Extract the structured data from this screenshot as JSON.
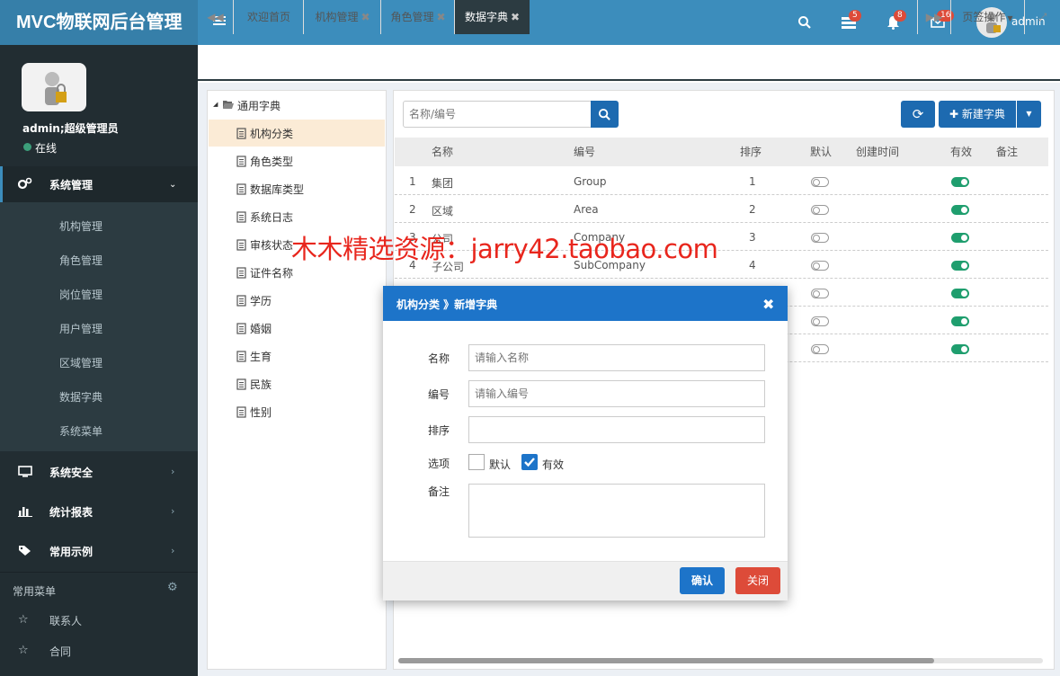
{
  "app": {
    "title": "MVC物联网后台管理"
  },
  "header": {
    "badge_tasks": "5",
    "badge_bell": "8",
    "badge_mail": "16",
    "username": "admin"
  },
  "user": {
    "name": "admin;超级管理员",
    "status": "在线"
  },
  "sidebar": {
    "system_mgmt": "系统管理",
    "sub_items": [
      "机构管理",
      "角色管理",
      "岗位管理",
      "用户管理",
      "区域管理",
      "数据字典",
      "系统菜单"
    ],
    "security": "系统安全",
    "stats": "统计报表",
    "examples": "常用示例",
    "common_menu": "常用菜单",
    "contacts": "联系人",
    "contract": "合同"
  },
  "tabs": {
    "home": "欢迎首页",
    "org": "机构管理",
    "role": "角色管理",
    "dict": "数据字典",
    "page_ops": "页签操作"
  },
  "tree": {
    "root": "通用字典",
    "items": [
      "机构分类",
      "角色类型",
      "数据库类型",
      "系统日志",
      "审核状态",
      "证件名称",
      "学历",
      "婚姻",
      "生育",
      "民族",
      "性别"
    ]
  },
  "toolbar": {
    "search_placeholder": "名称/编号",
    "new_button": "新建字典"
  },
  "table": {
    "headers": [
      "名称",
      "编号",
      "排序",
      "默认",
      "创建时间",
      "有效",
      "备注"
    ],
    "rows": [
      {
        "n": "1",
        "name": "集团",
        "code": "Group",
        "sort": "1"
      },
      {
        "n": "2",
        "name": "区域",
        "code": "Area",
        "sort": "2"
      },
      {
        "n": "3",
        "name": "公司",
        "code": "Company",
        "sort": "3"
      },
      {
        "n": "4",
        "name": "子公司",
        "code": "SubCompany",
        "sort": "4"
      }
    ]
  },
  "watermark": "木木精选资源：jarry42.taobao.com",
  "modal": {
    "title": "机构分类 》新增字典",
    "name_label": "名称",
    "name_placeholder": "请输入名称",
    "code_label": "编号",
    "code_placeholder": "请输入编号",
    "sort_label": "排序",
    "options_label": "选项",
    "default_label": "默认",
    "valid_label": "有效",
    "remark_label": "备注",
    "confirm": "确认",
    "close": "关闭"
  },
  "colors": {
    "header": "#3c8dbc",
    "logo": "#367fa9",
    "sidebar": "#222d32",
    "modal_header": "#1d74c9",
    "confirm": "#1d74c9",
    "close": "#dd4b39",
    "switch_on": "#1f9e6e"
  }
}
